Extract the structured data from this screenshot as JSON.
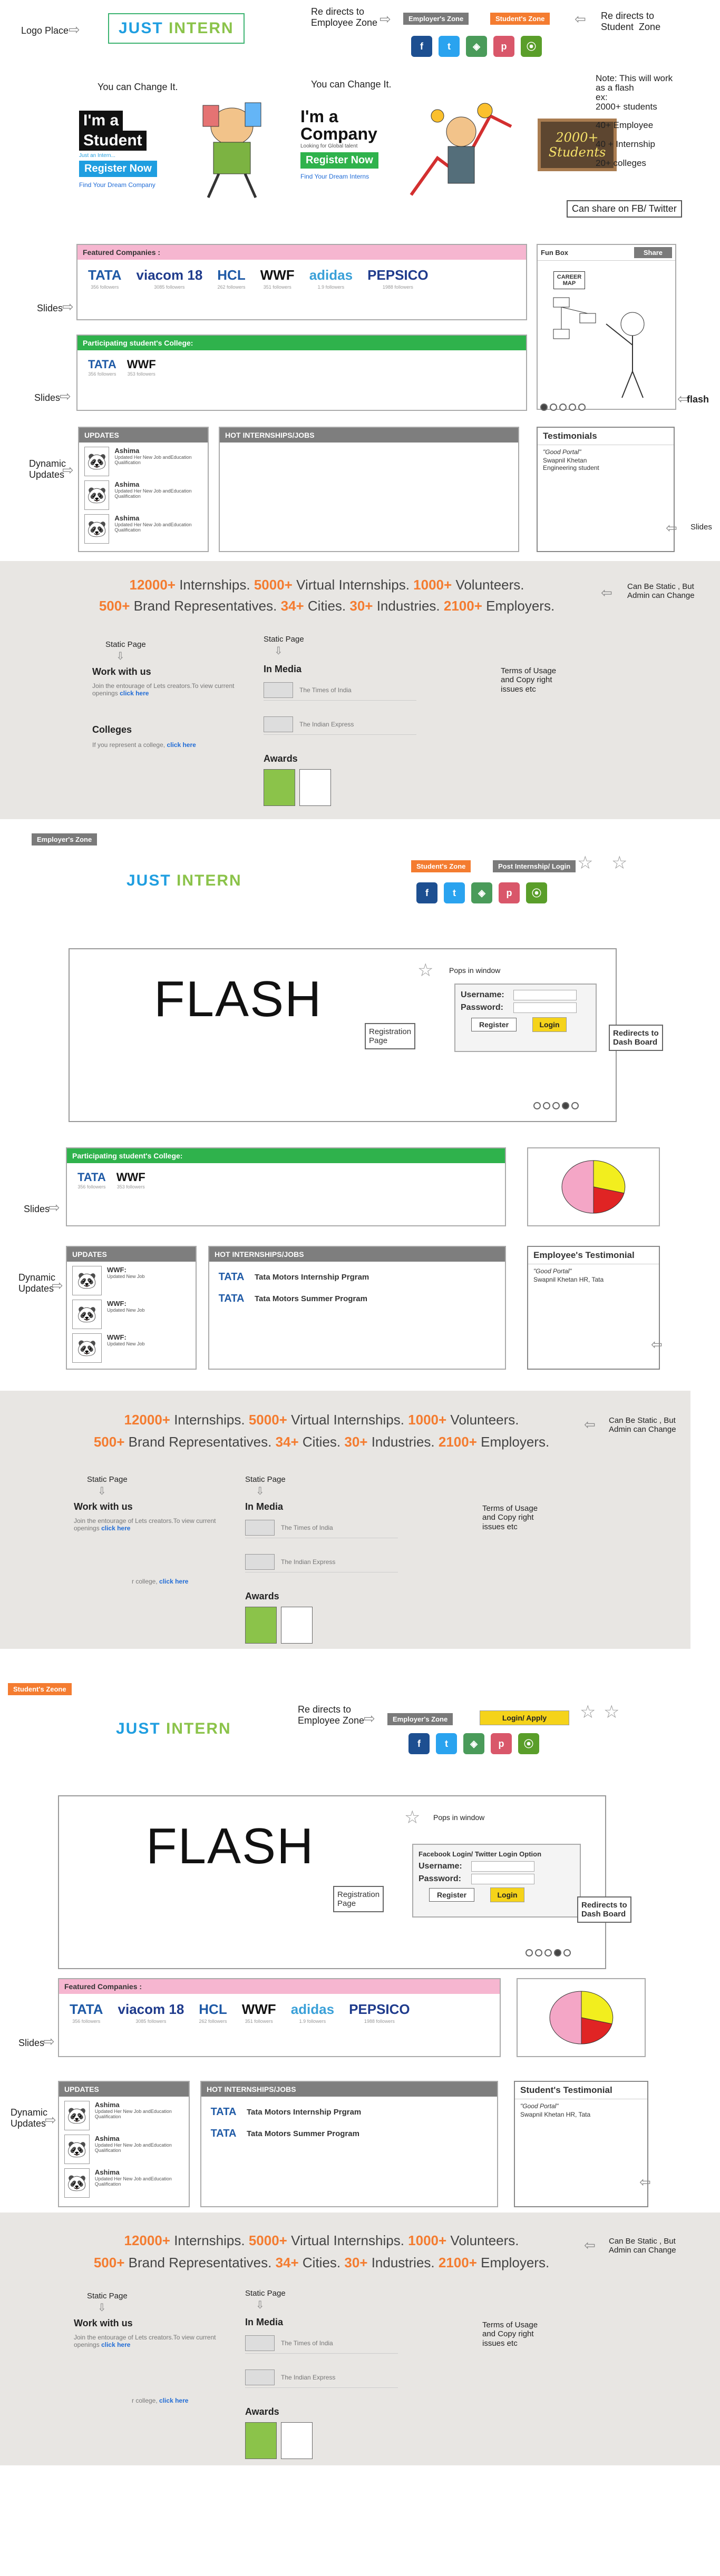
{
  "section1": {
    "logo_place_label": "Logo Place",
    "logo_text_just": "JUST",
    "logo_text_intern": "INTERN",
    "redirect_employee_note": "Re directs to\nEmployee Zone",
    "employers_zone_btn": "Employer's Zone",
    "students_zone_btn": "Student's Zone",
    "redirect_student_note": "Re directs to\nStudent  Zone",
    "change_note_1": "You can Change It.",
    "change_note_2": "You can Change It.",
    "student_banner": {
      "title1": "I'm a",
      "title2": "Student",
      "sub": "Just an Intern...",
      "btn": "Register Now",
      "link": "Find Your Dream Company"
    },
    "company_banner": {
      "title1": "I'm a",
      "title2": "Company",
      "sub": "Looking for Global talent",
      "btn": "Register Now",
      "link": "Find Your Dream Interns"
    },
    "flash_note": "Note: This will work\nas a flash\nex:\n2000+ students\n\n40+ Employee\n\n40 + Internship\n\n20+ colleges",
    "chalk_text": "2000+ Students",
    "share_note": "Can share on FB/ Twitter",
    "featured_title": "Featured Companies :",
    "featured": [
      {
        "name": "TATA",
        "followers": "356 followers",
        "color": "#1f5aa6"
      },
      {
        "name": "viacom 18",
        "followers": "3085 followers",
        "color": "#1f3b8c"
      },
      {
        "name": "HCL",
        "followers": "262 followers",
        "color": "#1f5aa6"
      },
      {
        "name": "WWF",
        "followers": "351 followers",
        "color": "#111111"
      },
      {
        "name": "adidas",
        "followers": "1.9 followers",
        "color": "#3aa0d8"
      },
      {
        "name": "PEPSICO",
        "followers": "1988 followers",
        "color": "#1f3b8c"
      }
    ],
    "slides_label_1": "Slides",
    "fun_box_title": "Fun Box",
    "fun_box_btn": "Share",
    "career_map": "CAREER MAP",
    "flash_label": "flash",
    "colleges_title": "Participating student's College:",
    "colleges": [
      {
        "name": "TATA",
        "followers": "356 followers"
      },
      {
        "name": "WWF",
        "followers": "353 followers"
      }
    ],
    "slides_label_2": "Slides",
    "dynamic_updates_label": "Dynamic\nUpdates",
    "updates_title": "UPDATES",
    "updates": [
      {
        "name": "Ashima",
        "text": "Updated Her New Job andEducation Qualification"
      },
      {
        "name": "Ashima",
        "text": "Updated Her New Job andEducation Qualification"
      },
      {
        "name": "Ashima",
        "text": "Updated Her New Job andEducation Qualification"
      }
    ],
    "hot_title": "HOT INTERNSHIPS/JOBS",
    "testimonials_title": "Testimonials",
    "testimonial_quote": "\"Good Portal\"",
    "testimonial_name": "Swapnil Khetan",
    "testimonial_role": "Engineering student",
    "slides_label_3": "Slides"
  },
  "footer_stats": {
    "a": "12000+",
    "a_t": " Internships. ",
    "b": "5000+",
    "b_t": " Virtual Internships. ",
    "c": "1000+",
    "c_t": " Volunteers.",
    "d": "500+",
    "d_t": " Brand Representatives. ",
    "e": "34+",
    "e_t": " Cities. ",
    "f": "30+",
    "f_t": " Industries. ",
    "g": "2100+",
    "g_t": " Employers."
  },
  "footer": {
    "static_note": "Can Be Static , But\nAdmin can Change",
    "static_page": "Static Page",
    "work_with_us": "Work with us",
    "work_desc": "Join the entourage of Lets creators.To view current openings",
    "click_here": "click here",
    "colleges": "Colleges",
    "colleges_desc": "If you represent a college,",
    "in_media": "In Media",
    "media_1": "The Times of India",
    "media_2": "The Indian Express",
    "awards": "Awards",
    "terms": "Terms of Usage\nand Copy right\nissues etc",
    "college_short": "r college,"
  },
  "section2": {
    "zone_label": "Employer's Zone",
    "students_zone_btn": "Student's Zone",
    "post_btn": "Post Internship/ Login",
    "pops_note": "Pops in window",
    "flash_word": "FLASH",
    "username": "Username:",
    "password": "Password:",
    "register": "Register",
    "login": "Login",
    "registration_page": "Registration\nPage",
    "redirect_dash": "Redirects to\nDash Board",
    "colleges_title": "Participating student's College:",
    "slides": "Slides",
    "dynamic_updates": "Dynamic\nUpdates",
    "updates_title": "UPDATES",
    "updates": [
      {
        "name": "WWF:",
        "text": "Updated New Job"
      },
      {
        "name": "WWF:",
        "text": "Updated New Job"
      },
      {
        "name": "WWF:",
        "text": "Updated New Job"
      }
    ],
    "hot_title": "HOT INTERNSHIPS/JOBS",
    "jobs": [
      {
        "title": "Tata Motors Internship Prgram"
      },
      {
        "title": "Tata Motors Summer Program"
      }
    ],
    "testi_title": "Employee's Testimonial",
    "testi_quote": "\"Good Portal\"",
    "testi_name": "Swapnil Khetan  HR, Tata"
  },
  "section3": {
    "zone_label": "Student's Zeone",
    "redirect_note": "Re directs to\nEmployee Zone",
    "employers_zone_btn": "Employer's Zone",
    "login_apply_btn": "Login/ Apply",
    "pops_note": "Pops in window",
    "flash_word": "FLASH",
    "fb_login": "Facebook Login/ Twitter Login Option",
    "username": "Username:",
    "password": "Password:",
    "register": "Register",
    "login": "Login",
    "registration_page": "Registration\nPage",
    "redirect_dash": "Redirects to\nDash Board",
    "featured_title": "Featured Companies :",
    "slides": "Slides",
    "dynamic_updates": "Dynamic\nUpdates",
    "updates_title": "UPDATES",
    "hot_title": "HOT INTERNSHIPS/JOBS",
    "jobs": [
      {
        "title": "Tata Motors Internship Prgram"
      },
      {
        "title": "Tata Motors Summer Program"
      }
    ],
    "testi_title": "Student's  Testimonial",
    "testi_quote": "\"Good Portal\"",
    "testi_name": "Swapnil Khetan  HR, Tata"
  },
  "colors": {
    "accent_orange": "#f47c30",
    "green": "#2fb24c",
    "pink": "#f6b6d0",
    "grey": "#7a7a7a",
    "footer_bg": "#e8e6e3"
  }
}
